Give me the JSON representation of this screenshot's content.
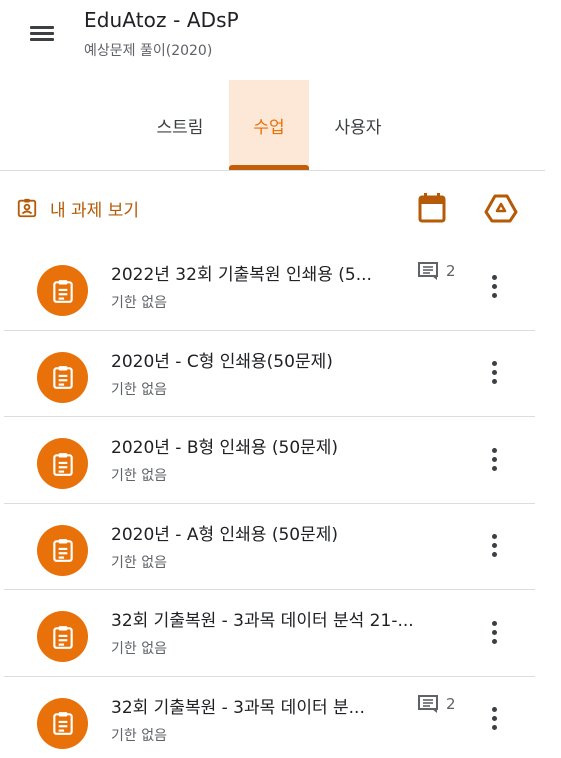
{
  "header": {
    "title": "EduAtoz - ADsP",
    "subtitle": "예상문제 풀이(2020)"
  },
  "tabs": [
    {
      "label": "스트림"
    },
    {
      "label": "수업",
      "selected": true
    },
    {
      "label": "사용자"
    }
  ],
  "toolbar": {
    "my_work_label": "내 과제 보기"
  },
  "colors": {
    "accent": "#e8710a",
    "accent_dark": "#b55a06",
    "tab_selected_bg": "#fde8d8"
  },
  "assignments": [
    {
      "title": "2022년 32회 기출복원 인쇄용 (5...",
      "due": "기한 없음",
      "comments": "2"
    },
    {
      "title": "2020년 - C형 인쇄용(50문제)",
      "due": "기한 없음"
    },
    {
      "title": "2020년 - B형 인쇄용 (50문제)",
      "due": "기한 없음"
    },
    {
      "title": "2020년 - A형 인쇄용 (50문제)",
      "due": "기한 없음"
    },
    {
      "title": "32회 기출복원 - 3과목 데이터 분석 21-...",
      "due": "기한 없음"
    },
    {
      "title": "32회 기출복원 - 3과목 데이터 분...",
      "due": "기한 없음",
      "comments": "2"
    }
  ]
}
